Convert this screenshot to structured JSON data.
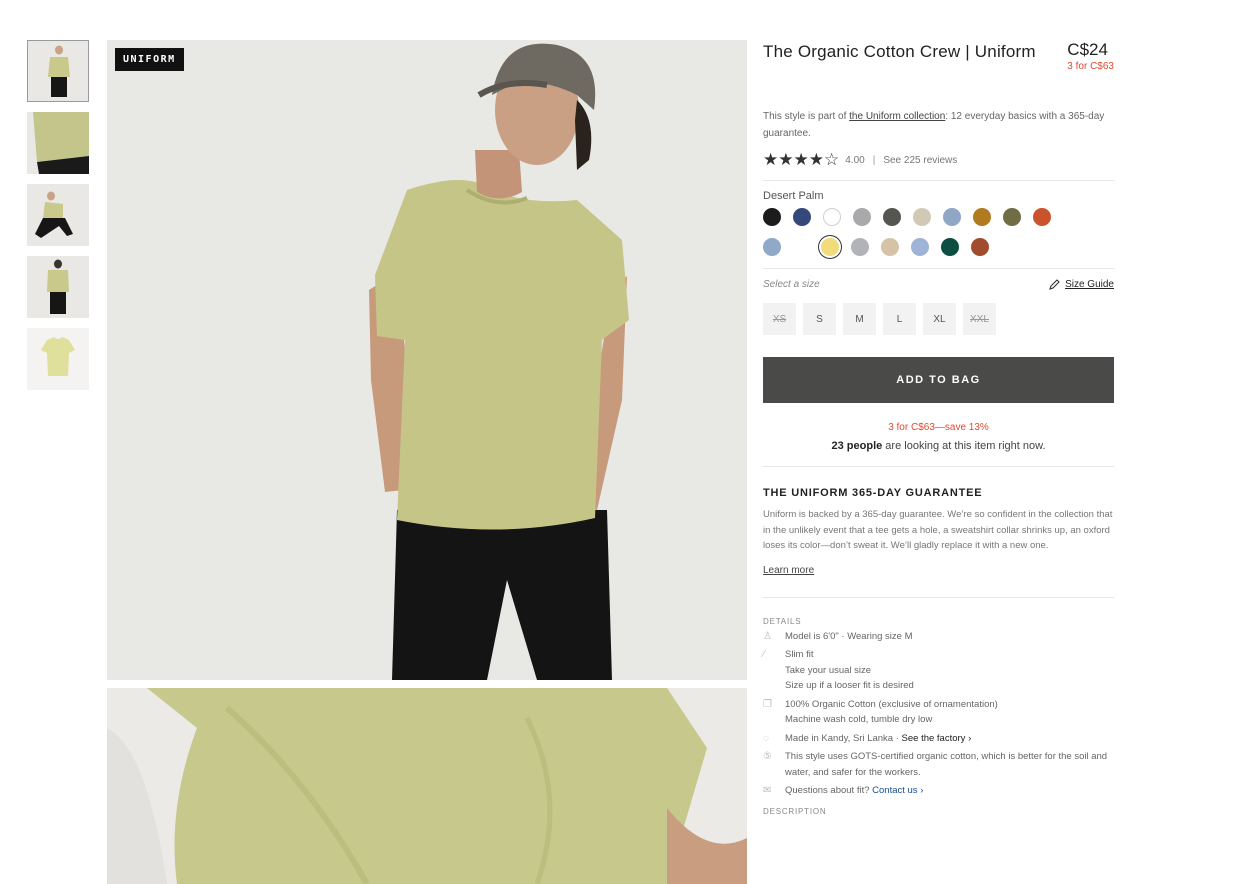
{
  "thumbnails": [
    {
      "name": "model-front"
    },
    {
      "name": "fabric-closeup"
    },
    {
      "name": "model-crouching"
    },
    {
      "name": "model-back"
    },
    {
      "name": "flat-lay"
    }
  ],
  "hero": {
    "badge": "UNIFORM"
  },
  "product": {
    "title": "The Organic Cotton Crew | Uniform",
    "price": "C$24",
    "multi_price": "3 for C$63",
    "collection_prefix": "This style is part of ",
    "collection_link": "the Uniform collection",
    "collection_suffix": ": 12 everyday basics with a 365-day guarantee.",
    "rating_value": "4.00",
    "rating_stars": 4,
    "reviews_link": "See 225 reviews",
    "color_name": "Desert Palm",
    "colors": [
      "#1c1c1c",
      "#34497a",
      "#ffffff",
      "#a9a9ab",
      "#555652",
      "#d2c8b6",
      "#8fa7c4",
      "#b27a1f",
      "#6f6c46",
      "#c9532c",
      "#8fa9c7",
      "#f0dc7d",
      "#b2b3b7",
      "#d6c3a7",
      "#9eb3d6",
      "#0d4e43",
      "#a14c2d"
    ],
    "selected_color_index": 11,
    "size_prompt": "Select a size",
    "size_guide": "Size Guide",
    "sizes": [
      {
        "label": "XS",
        "available": false
      },
      {
        "label": "S",
        "available": true
      },
      {
        "label": "M",
        "available": true
      },
      {
        "label": "L",
        "available": true
      },
      {
        "label": "XL",
        "available": true
      },
      {
        "label": "XXL",
        "available": false
      }
    ],
    "add_to_bag": "ADD TO BAG",
    "promo": "3 for C$63—save 13%",
    "looking_count": "23 people",
    "looking_text": " are looking at this item right now."
  },
  "guarantee": {
    "title": "THE UNIFORM 365-DAY GUARANTEE",
    "body": "Uniform is backed by a 365-day guarantee. We’re so confident in the collection that in the unlikely event that a tee gets a hole, a sweatshirt collar shrinks up, an oxford loses its color—don’t sweat it. We’ll gladly replace it with a new one.",
    "learn_more": "Learn more"
  },
  "details": {
    "heading": "DETAILS",
    "model": "Model is 6'0\" · Wearing size M",
    "fit_1": "Slim fit",
    "fit_2": "Take your usual size",
    "fit_3": "Size up if a looser fit is desired",
    "material_1": "100% Organic Cotton (exclusive of ornamentation)",
    "material_2": "Machine wash cold, tumble dry low",
    "made_in": "Made in Kandy, Sri Lanka · ",
    "factory_link": "See the factory ›",
    "gots": "This style uses GOTS-certified organic cotton, which is better for the soil and water, and safer for the workers.",
    "questions": "Questions about fit? ",
    "contact_link": "Contact us ›",
    "description_heading": "DESCRIPTION"
  },
  "icons": {
    "person": "person-icon",
    "hanger": "hanger-icon",
    "fabric": "fabric-icon",
    "location": "location-pin-icon",
    "certified": "certified-icon",
    "mail": "mail-icon",
    "pencil": "pencil-icon",
    "star": "star-icon"
  }
}
